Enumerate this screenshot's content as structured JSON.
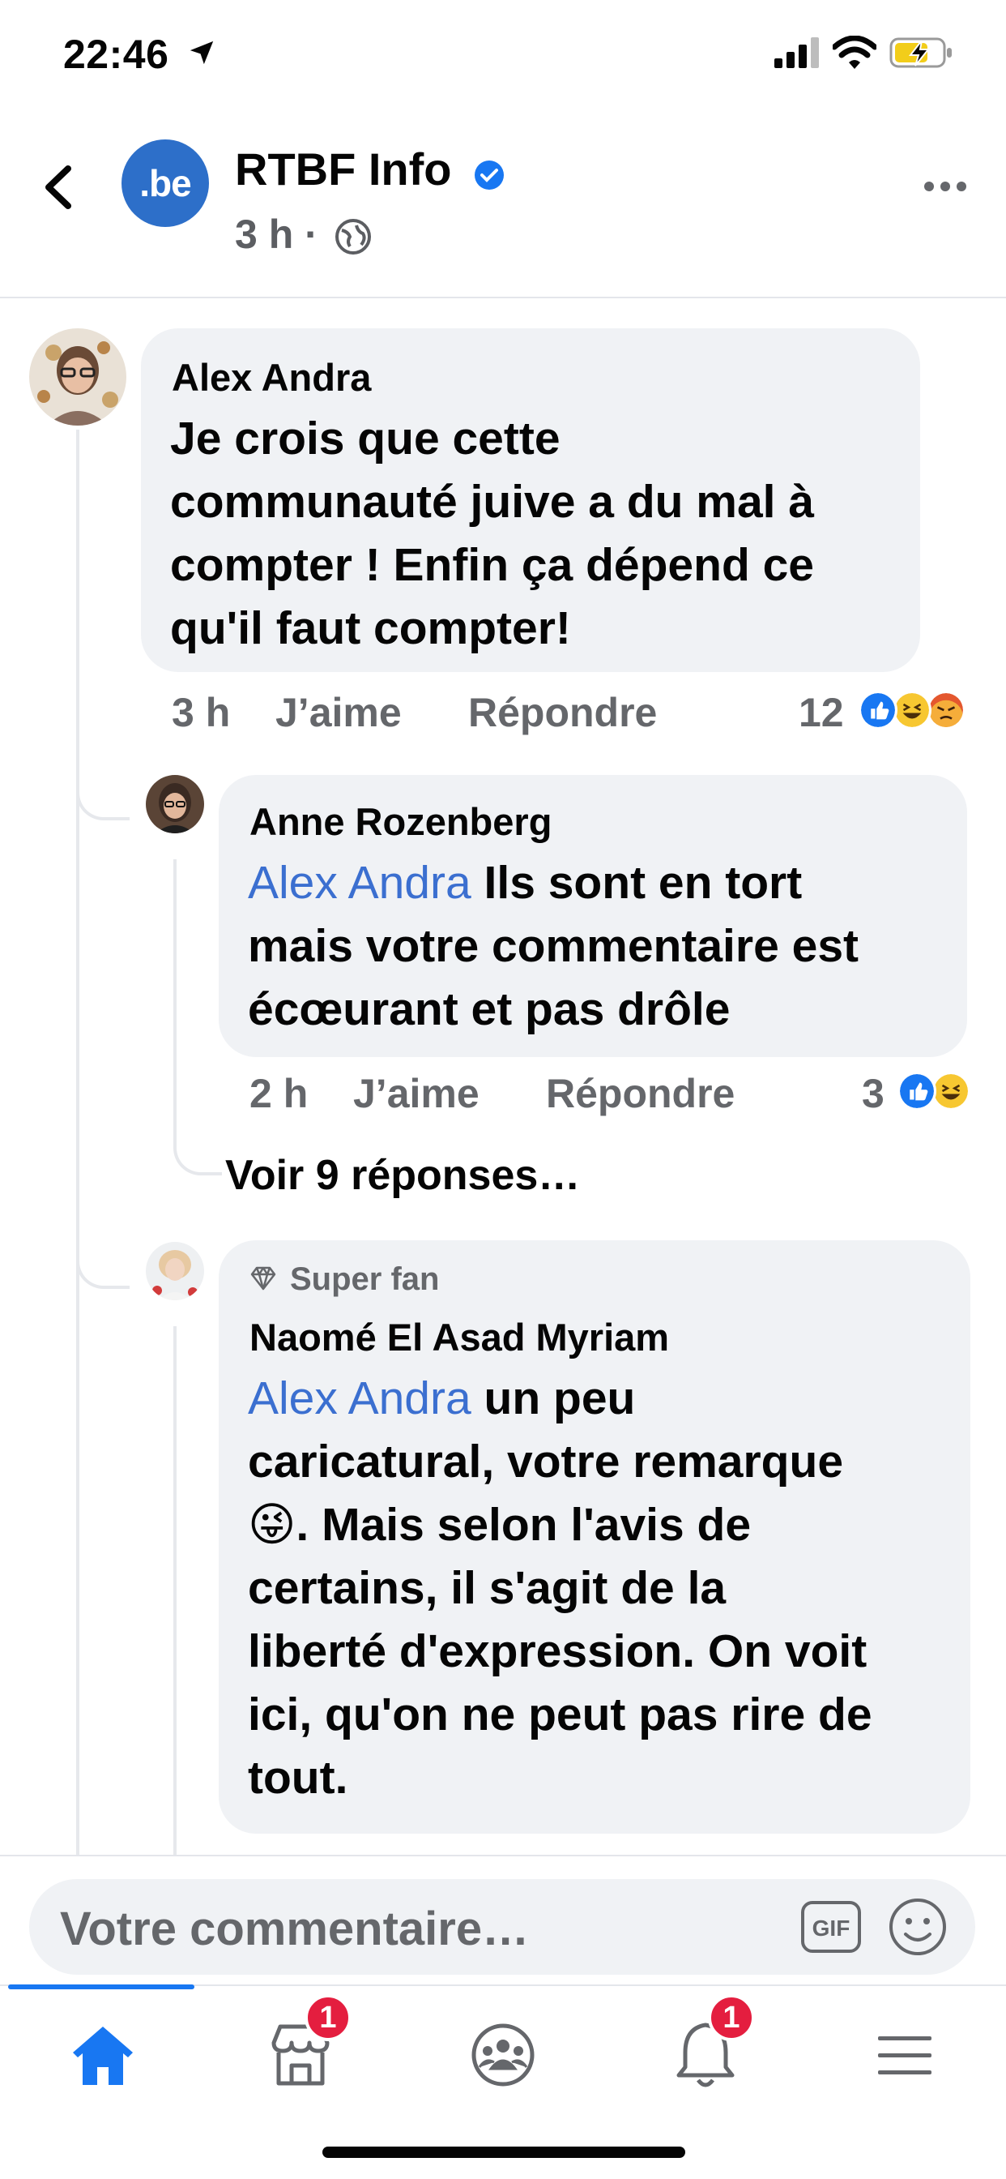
{
  "status_bar": {
    "time": "22:46"
  },
  "header": {
    "page_name": "RTBF Info",
    "logo_text": ".be",
    "post_time": "3 h ·"
  },
  "comments": [
    {
      "author": "Alex Andra",
      "text_lines": [
        "Je crois que cette",
        "communauté juive a du mal à",
        "compter ! Enfin ça dépend ce",
        "qu'il faut compter!"
      ],
      "time": "3 h",
      "like_label": "J’aime",
      "reply_label": "Répondre",
      "reaction_count": "12",
      "reactions": [
        "like",
        "haha",
        "angry"
      ]
    },
    {
      "author": "Anne Rozenberg",
      "mention": "Alex Andra",
      "text_lines": [
        " Ils sont en tort",
        "mais votre commentaire est",
        "écœurant et pas drôle"
      ],
      "time": "2 h",
      "like_label": "J’aime",
      "reply_label": "Répondre",
      "reaction_count": "3",
      "reactions": [
        "like",
        "haha"
      ]
    },
    {
      "badge": "Super fan",
      "author": "Naomé El Asad Myriam",
      "mention": "Alex Andra",
      "text_lines": [
        " un peu",
        "caricatural,  votre remarque",
        ". Mais selon l'avis de",
        "certains, il s'agit de la",
        "liberté d'expression. On voit",
        "ici, qu'on ne peut pas rire de",
        "tout."
      ],
      "emoji": "😜"
    }
  ],
  "view_more_replies": "Voir 9 réponses…",
  "composer": {
    "placeholder": "Votre commentaire…",
    "gif_label": "GIF"
  },
  "tabbar": {
    "items": [
      "home",
      "marketplace",
      "groups",
      "notifications",
      "menu"
    ],
    "marketplace_badge": "1",
    "notifications_badge": "1"
  },
  "colors": {
    "accent": "#1877f2",
    "mention": "#3b6fd0",
    "bubble": "#f0f2f5",
    "badge": "#e41e3f"
  }
}
